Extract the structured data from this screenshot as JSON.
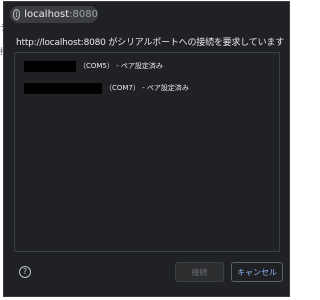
{
  "background": {
    "fragment_1": "テ",
    "fragment_2": "接"
  },
  "origin": {
    "host": "localhost",
    "port": ":8080"
  },
  "dialog": {
    "title": "http://localhost:8080 がシリアルポートへの接続を要求しています"
  },
  "ports": [
    {
      "label": "（COM5） - ペア設定済み"
    },
    {
      "label": "（COM7） - ペア設定済み"
    }
  ],
  "buttons": {
    "connect": "接続",
    "cancel": "キャンセル"
  },
  "icons": {
    "info": "info-icon",
    "help": "help-icon"
  },
  "colors": {
    "dialog_bg": "#202124",
    "accent": "#8ab4f8",
    "redaction": "#000000"
  }
}
